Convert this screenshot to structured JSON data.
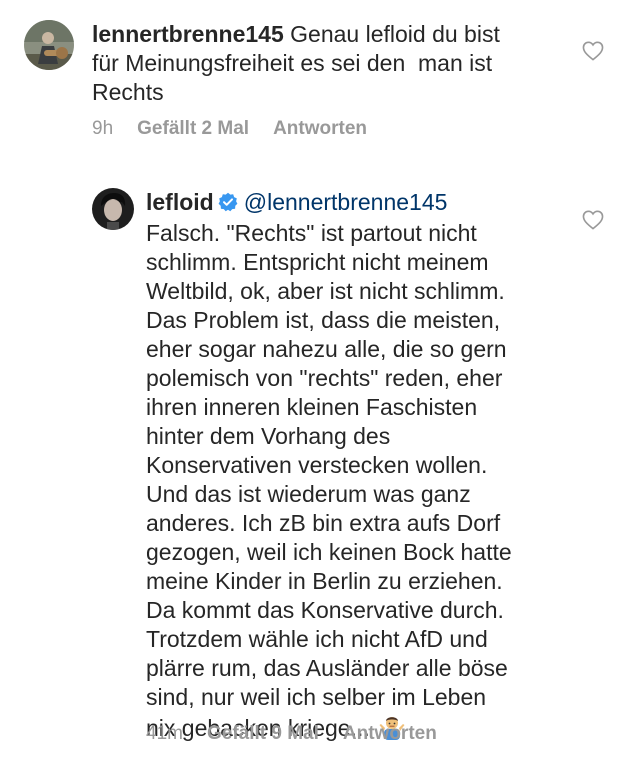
{
  "comments": [
    {
      "username": "lennertbrenne145",
      "text": " Genau lefloid du bist\nfür Meinungsfreiheit es sei den  man ist\nRechts",
      "time": "9h",
      "likes": "Gefällt 2 Mal",
      "reply_label": "Antworten"
    },
    {
      "username": "lefloid",
      "verified": true,
      "mention": "@lennertbrenne145",
      "text": "Falsch. \"Rechts\" ist partout nicht\nschlimm. Entspricht nicht meinem\nWeltbild, ok, aber ist nicht schlimm.\nDas Problem ist, dass die meisten,\neher sogar nahezu alle, die so gern\npolemisch von \"rechts\" reden, eher\nihren inneren kleinen Faschisten\nhinter dem Vorhang des\nKonservativen verstecken wollen.\nUnd das ist wiederum was ganz\nanderes. Ich zB bin extra aufs Dorf\ngezogen, weil ich keinen Bock hatte\nmeine Kinder in Berlin zu erziehen.\nDa kommt das Konservative durch.\nTrotzdem wähle ich nicht AfD und\nplärre rum, das Ausländer alle böse\nsind, nur weil ich selber im Leben\nnix gebacken kriege...",
      "emoji": "man-shrugging-emoji",
      "time": "41m",
      "likes": "Gefällt 9 Mal",
      "reply_label": "Antworten"
    }
  ],
  "colors": {
    "text": "#262626",
    "meta": "#999999",
    "mention": "#003569",
    "verified": "#3897f0"
  }
}
